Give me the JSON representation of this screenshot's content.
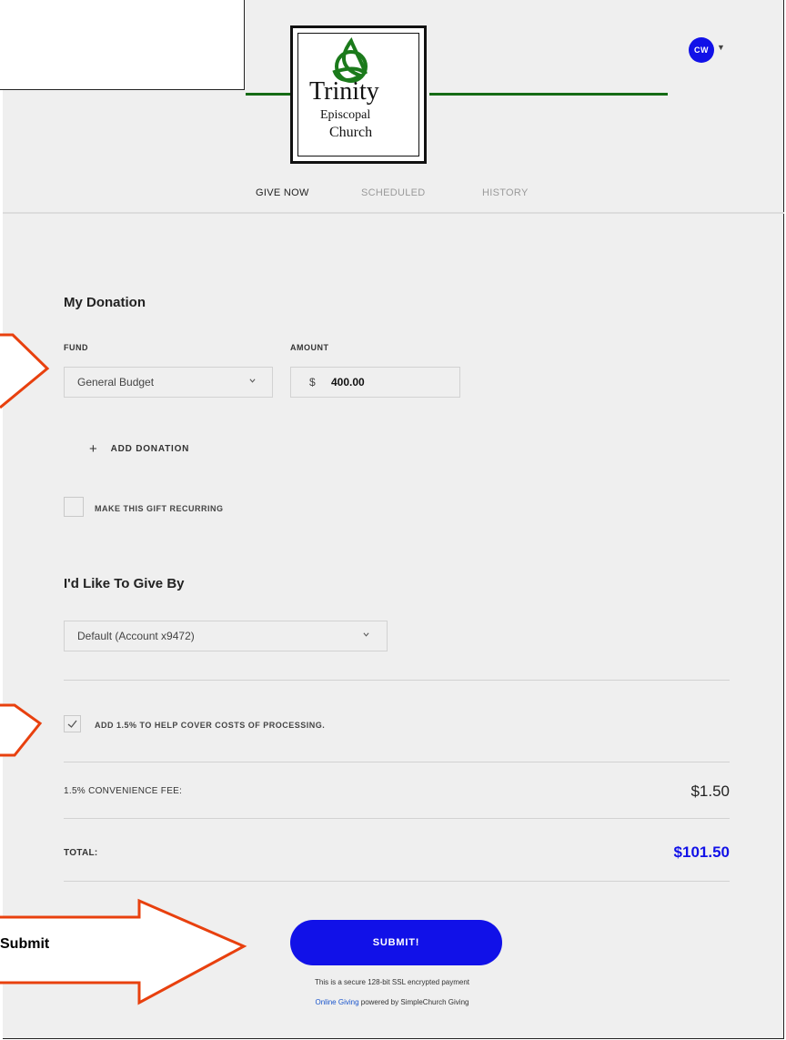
{
  "tabs": {
    "give_now": "GIVE NOW",
    "scheduled": "SCHEDULED",
    "history": "HISTORY"
  },
  "avatar": {
    "initials": "CW"
  },
  "logo": {
    "line1": "Trinity",
    "line2": "Episcopal",
    "line3": "Church"
  },
  "donation": {
    "title": "My Donation",
    "fund_label": "FUND",
    "amount_label": "AMOUNT",
    "fund_value": "General Budget",
    "currency": "$",
    "amount_value": "400.00",
    "add_label": "ADD DONATION",
    "recurring_label": "MAKE THIS GIFT RECURRING",
    "recurring_checked": false
  },
  "give_by": {
    "title": "I'd Like To Give By",
    "method_value": "Default (Account x9472)"
  },
  "processing": {
    "label": "ADD 1.5% TO HELP COVER COSTS OF PROCESSING.",
    "checked": true
  },
  "summary": {
    "fee_label": "1.5% CONVENIENCE FEE:",
    "fee_value": "$1.50",
    "total_label": "TOTAL:",
    "total_value": "$101.50"
  },
  "submit": {
    "label": "SUBMIT!"
  },
  "footer": {
    "secure": "This is a secure 128-bit SSL encrypted payment",
    "link": "Online Giving",
    "powered": " powered by SimpleChurch Giving"
  },
  "callout": {
    "submit_text": "Submit"
  },
  "colors": {
    "accent": "#1111e8",
    "green": "#156b15",
    "callout": "#e8400e"
  }
}
